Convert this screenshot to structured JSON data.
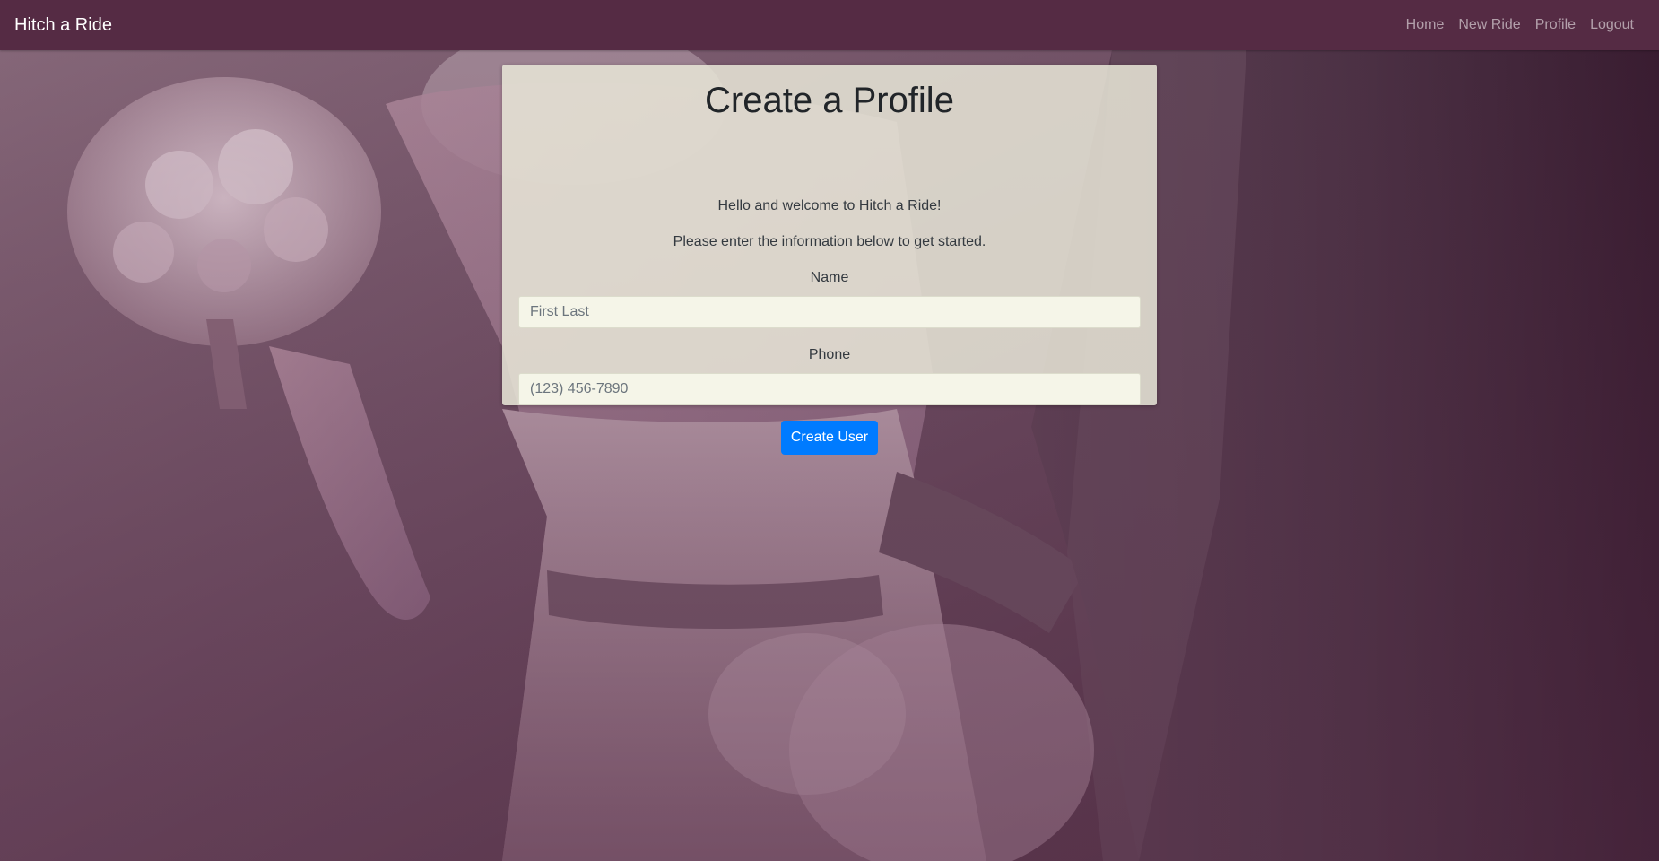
{
  "navbar": {
    "brand": "Hitch a Ride",
    "links": [
      "Home",
      "New Ride",
      "Profile",
      "Logout"
    ],
    "background_color": "#552b44"
  },
  "card": {
    "title": "Create a Profile",
    "welcome": "Hello and welcome to Hitch a Ride!",
    "instructions": "Please enter the information below to get started.",
    "name_label": "Name",
    "name_placeholder": "First Last",
    "name_value": "",
    "phone_label": "Phone",
    "phone_placeholder": "(123) 456-7890",
    "phone_value": "",
    "submit_label": "Create User"
  },
  "colors": {
    "accent": "#007bff",
    "overlay_tint": "#5a2f4a"
  }
}
